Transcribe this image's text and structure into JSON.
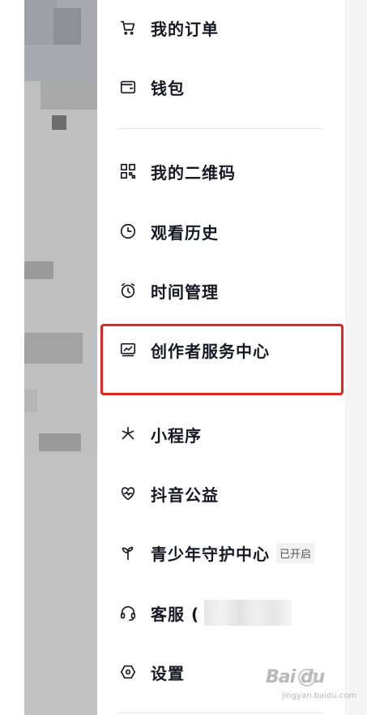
{
  "menu": {
    "items": [
      {
        "id": "orders",
        "label": "我的订单",
        "icon": "cart-icon"
      },
      {
        "id": "wallet",
        "label": "钱包",
        "icon": "wallet-icon"
      },
      {
        "id": "qrcode",
        "label": "我的二维码",
        "icon": "qr-code-icon"
      },
      {
        "id": "history",
        "label": "观看历史",
        "icon": "clock-icon"
      },
      {
        "id": "time",
        "label": "时间管理",
        "icon": "alarm-clock-icon"
      },
      {
        "id": "creator",
        "label": "创作者服务中心",
        "icon": "chart-monitor-icon"
      },
      {
        "id": "miniapp",
        "label": "小程序",
        "icon": "asterisk-icon"
      },
      {
        "id": "charity",
        "label": "抖音公益",
        "icon": "heart-pulse-icon"
      },
      {
        "id": "youth",
        "label": "青少年守护中心",
        "icon": "sprout-icon",
        "badge": "已开启"
      },
      {
        "id": "service",
        "label": "客服 (",
        "icon": "headset-icon"
      },
      {
        "id": "settings",
        "label": "设置",
        "icon": "hexagon-gear-icon"
      }
    ]
  },
  "highlight": {
    "target": "creator",
    "color": "#e52421"
  },
  "watermark": {
    "brand": "Bai du",
    "domain": "jingyan.baidu.com"
  },
  "colors": {
    "text": "#161823",
    "divider": "#e8e8e8"
  }
}
